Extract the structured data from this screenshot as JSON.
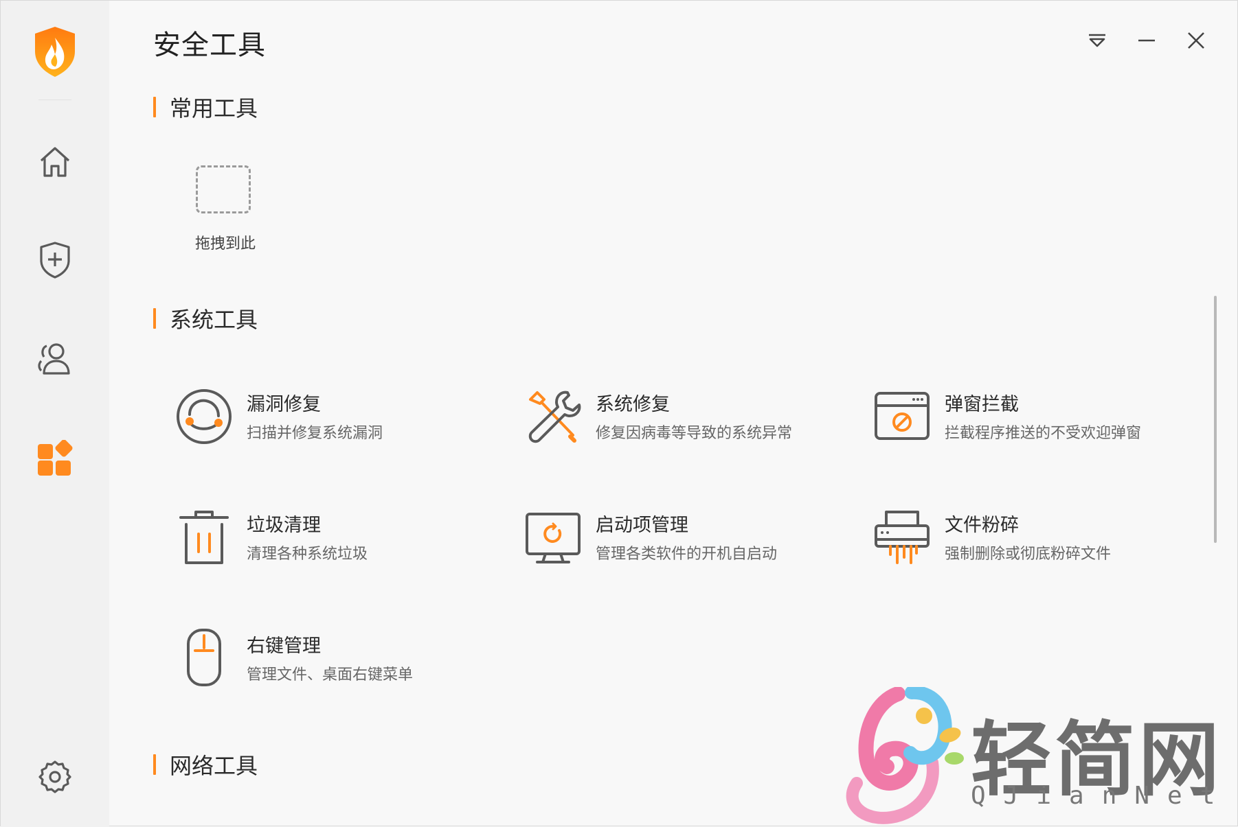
{
  "window": {
    "title": "安全工具"
  },
  "sections": {
    "common": {
      "title": "常用工具",
      "drag_label": "拖拽到此"
    },
    "system": {
      "title": "系统工具"
    },
    "network": {
      "title": "网络工具"
    }
  },
  "tools": [
    {
      "name": "漏洞修复",
      "desc": "扫描并修复系统漏洞",
      "icon": "vulnerability-repair-icon"
    },
    {
      "name": "系统修复",
      "desc": "修复因病毒等导致的系统异常",
      "icon": "wrench-screwdriver-icon"
    },
    {
      "name": "弹窗拦截",
      "desc": "拦截程序推送的不受欢迎弹窗",
      "icon": "popup-block-icon"
    },
    {
      "name": "垃圾清理",
      "desc": "清理各种系统垃圾",
      "icon": "trash-icon"
    },
    {
      "name": "启动项管理",
      "desc": "管理各类软件的开机自启动",
      "icon": "monitor-startup-icon"
    },
    {
      "name": "文件粉碎",
      "desc": "强制删除或彻底粉碎文件",
      "icon": "shredder-icon"
    },
    {
      "name": "右键管理",
      "desc": "管理文件、桌面右键菜单",
      "icon": "mouse-icon"
    }
  ],
  "watermark": {
    "text": "轻简网",
    "sub": "QJianNet"
  },
  "colors": {
    "accent": "#ff8a1f",
    "icon_gray": "#5a5a5a",
    "sidebar_bg": "#f1f1f1",
    "content_bg": "#f8f8f8"
  }
}
